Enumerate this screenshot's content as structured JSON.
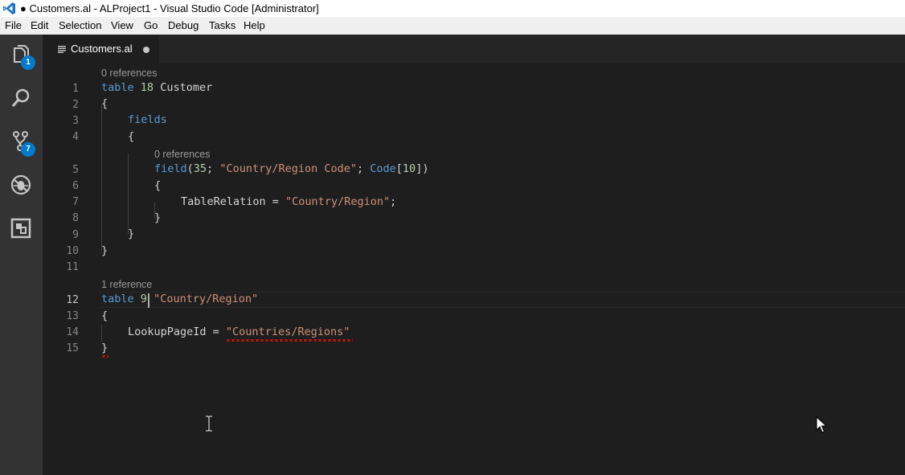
{
  "window": {
    "title": "● Customers.al - ALProject1 - Visual Studio Code [Administrator]"
  },
  "menu": [
    "File",
    "Edit",
    "Selection",
    "View",
    "Go",
    "Debug",
    "Tasks",
    "Help"
  ],
  "activity_bar": {
    "explorer_badge": "1",
    "scm_badge": "7"
  },
  "tab": {
    "label": "Customers.al"
  },
  "colors": {
    "accent": "#007acc",
    "keyword": "#569cd6",
    "string": "#ce9178",
    "number": "#b5cea8",
    "error": "#e51400"
  },
  "editor": {
    "line_numbers": [
      "1",
      "2",
      "3",
      "4",
      "5",
      "6",
      "7",
      "8",
      "9",
      "10",
      "11",
      "12",
      "13",
      "14",
      "15"
    ],
    "active_line": "12",
    "codelens": {
      "l1": "0 references",
      "l5": "0 references",
      "l12": "1 reference"
    },
    "code": {
      "l1_kw": "table",
      "l1_num": "18",
      "l1_name": "Customer",
      "l2": "{",
      "l3_kw": "fields",
      "l4": "{",
      "l5_kw": "field",
      "l5_open": "(",
      "l5_num": "35",
      "l5_sep": "; ",
      "l5_str": "\"Country/Region Code\"",
      "l5_sep2": "; ",
      "l5_type": "Code",
      "l5_br_open": "[",
      "l5_len": "10",
      "l5_close": "])",
      "l6": "{",
      "l7_prop": "TableRelation = ",
      "l7_str": "\"Country/Region\"",
      "l7_end": ";",
      "l8": "}",
      "l9": "}",
      "l10": "}",
      "l12_kw": "table",
      "l12_num": "9",
      "l12_str": "\"Country/Region\"",
      "l13": "{",
      "l14_prop": "LookupPageId = ",
      "l14_str": "\"Countries/Regions\"",
      "l15": "}"
    }
  }
}
